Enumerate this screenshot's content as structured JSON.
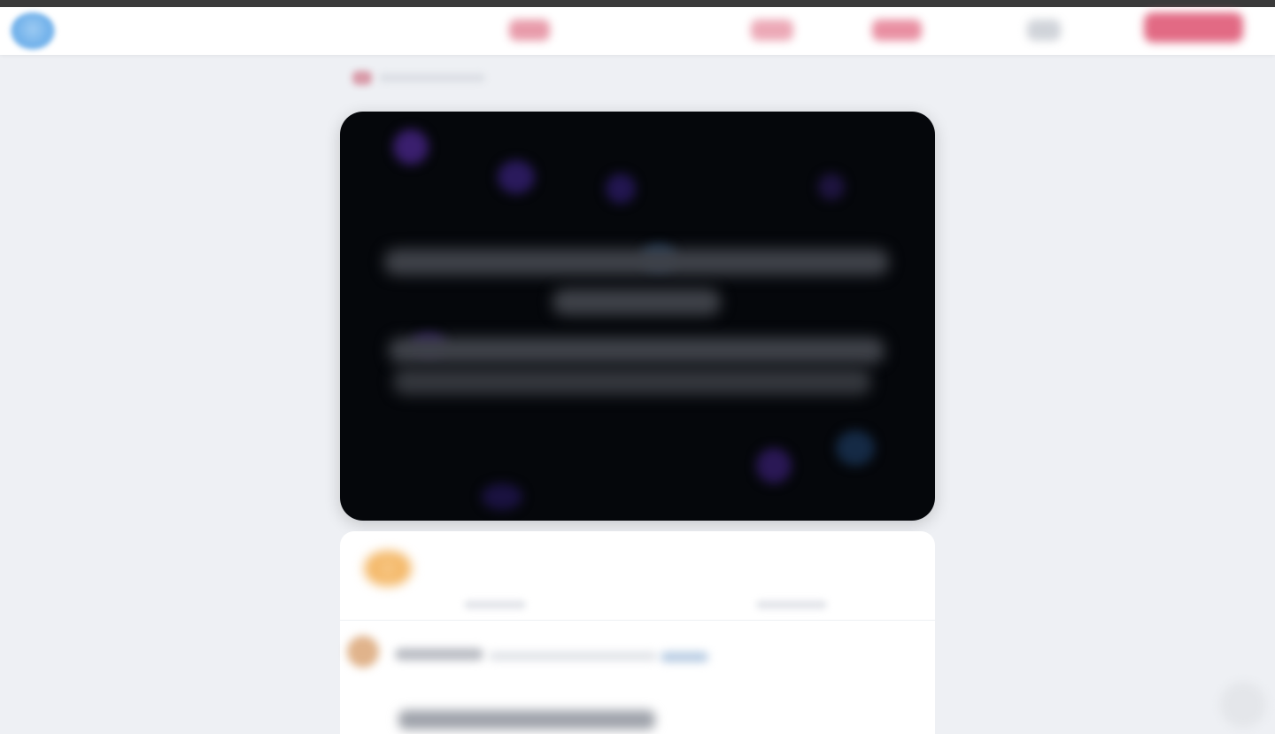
{
  "header": {
    "logo_icon": "app-logo-icon",
    "nav_items": [
      {
        "label": "",
        "color": "#e48a9c"
      },
      {
        "label": "",
        "color": "#e99aaa"
      },
      {
        "label": "",
        "color": "#e57c92"
      },
      {
        "label": "",
        "color": "#c8ccd3"
      }
    ],
    "cta_label": "",
    "cta_color": "#e26a84"
  },
  "breadcrumb": {
    "text": ""
  },
  "hero": {
    "background": "#05070b",
    "headline": ""
  },
  "post": {
    "reactions_icon": "reactions-emoji-icon",
    "reaction_count": "",
    "comment_count": "",
    "author_name": "",
    "author_link": "",
    "body": ""
  },
  "floating_action": {
    "icon": "help-icon"
  }
}
